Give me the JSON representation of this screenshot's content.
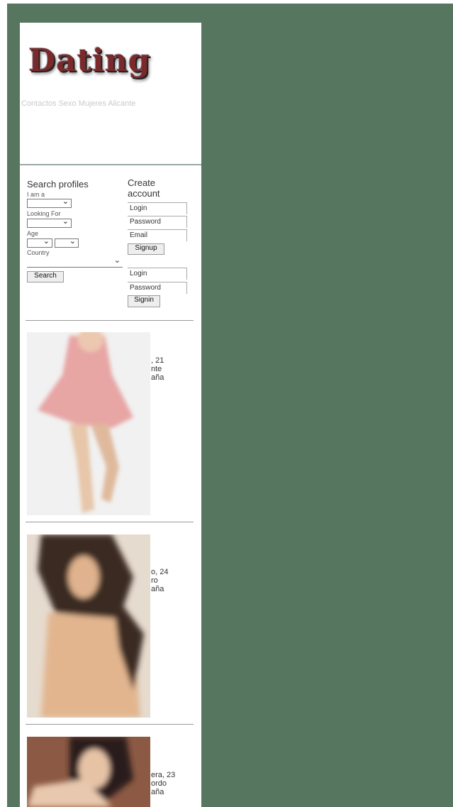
{
  "site": {
    "logo_text": "Dating",
    "tagline": "Contactos Sexo Mujeres Alicante"
  },
  "search": {
    "title": "Search profiles",
    "i_am_label": "I am a",
    "looking_for_label": "Looking For",
    "age_label": "Age",
    "country_label": "Country",
    "search_button": "Search"
  },
  "create_account": {
    "title": "Create account",
    "login_placeholder": "Login",
    "password_placeholder": "Password",
    "email_placeholder": "Email",
    "signup_button": "Signup"
  },
  "signin": {
    "login_placeholder": "Login",
    "password_placeholder": "Password",
    "signin_button": "Signin"
  },
  "profiles": [
    {
      "line1": ", 21",
      "line2": "nte",
      "line3": "aña"
    },
    {
      "line1": "o, 24",
      "line2": "ro",
      "line3": "aña"
    },
    {
      "line1": "era, 23",
      "line2": "ordo",
      "line3": "aña"
    }
  ],
  "colors": {
    "background": "#577660",
    "panel": "#ffffff"
  }
}
